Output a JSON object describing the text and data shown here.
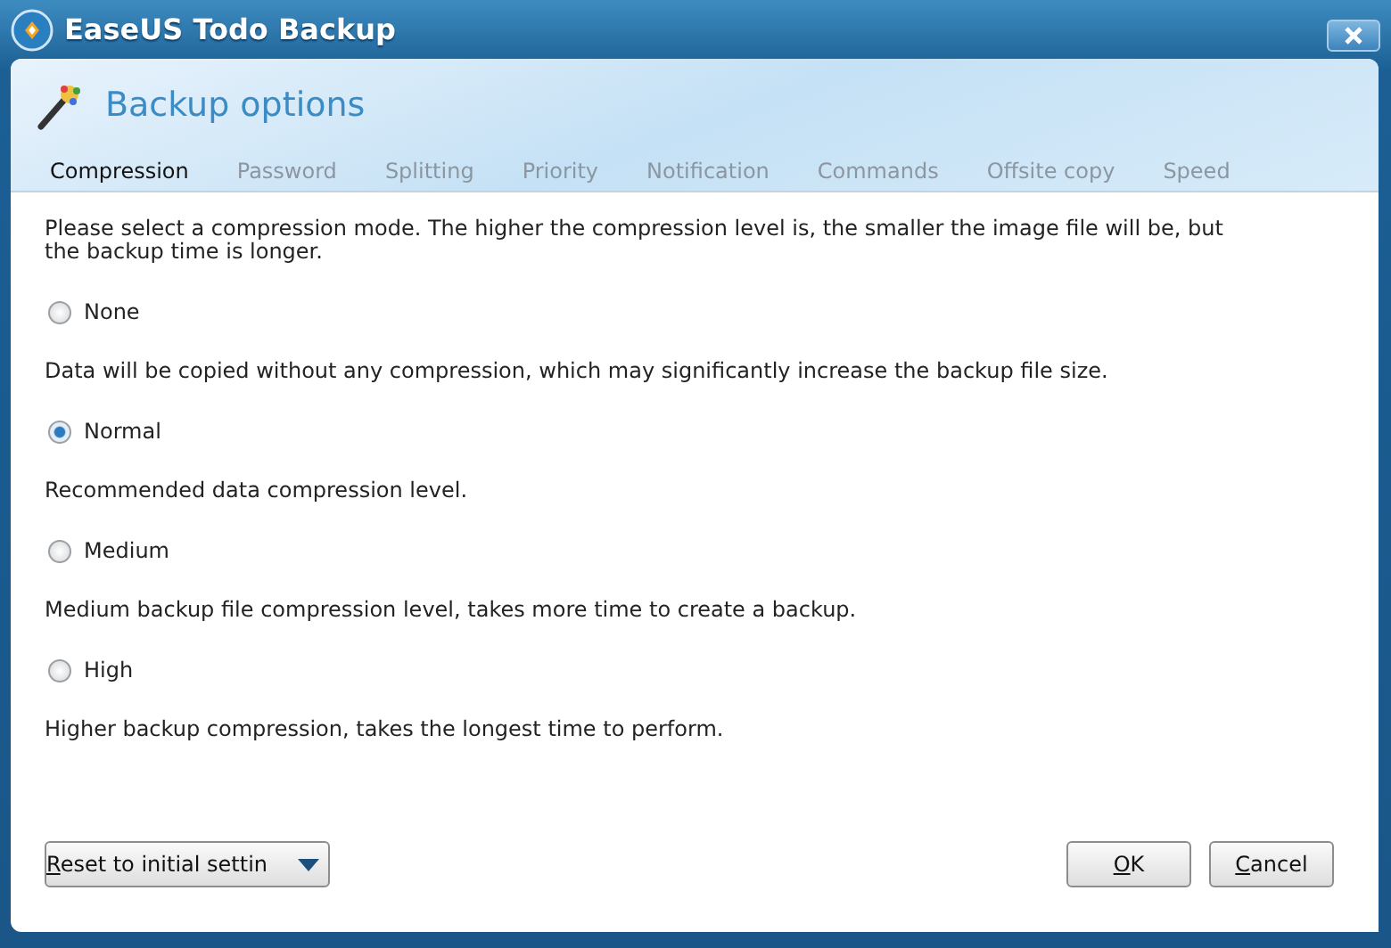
{
  "window": {
    "title": "EaseUS Todo Backup"
  },
  "header": {
    "title": "Backup options"
  },
  "tabs": [
    {
      "label": "Compression",
      "selected": true
    },
    {
      "label": "Password",
      "selected": false
    },
    {
      "label": "Splitting",
      "selected": false
    },
    {
      "label": "Priority",
      "selected": false
    },
    {
      "label": "Notification",
      "selected": false
    },
    {
      "label": "Commands",
      "selected": false
    },
    {
      "label": "Offsite copy",
      "selected": false
    },
    {
      "label": "Speed",
      "selected": false
    }
  ],
  "intro": "Please select a compression mode. The higher the compression level is, the smaller the image file will be, but the backup time is longer.",
  "options": [
    {
      "label": "None",
      "selected": false,
      "description": "Data will be copied without any compression, which may significantly increase the backup file size."
    },
    {
      "label": "Normal",
      "selected": true,
      "description": "Recommended data compression level."
    },
    {
      "label": "Medium",
      "selected": false,
      "description": "Medium backup file compression level, takes more time to create a backup."
    },
    {
      "label": "High",
      "selected": false,
      "description": "Higher backup compression, takes the longest time to perform."
    }
  ],
  "reset_button": "Reset to initial settin",
  "buttons": [
    "OK",
    "Cancel"
  ]
}
